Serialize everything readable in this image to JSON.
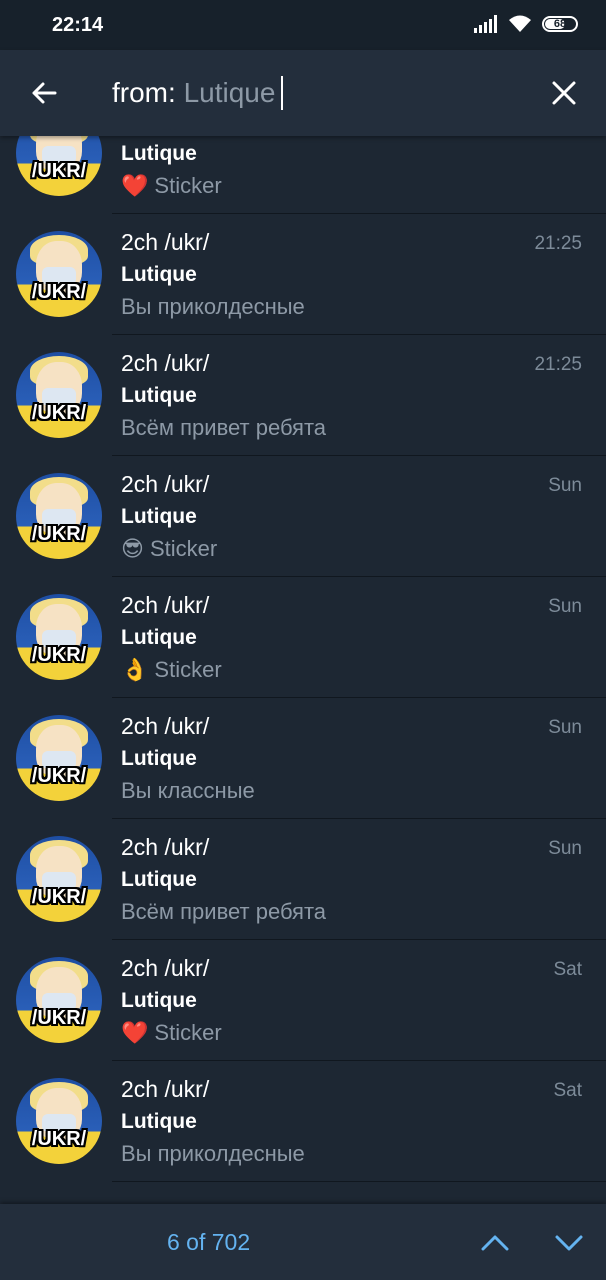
{
  "status_bar": {
    "time": "22:14",
    "battery": "68",
    "battery_level": 0.68
  },
  "search": {
    "prefix": "from: ",
    "query": "Lutique"
  },
  "colors": {
    "accent": "#64b3f0",
    "background": "#1d2733",
    "header": "#232e3c",
    "muted_text": "#8d99a6"
  },
  "results": [
    {
      "title": "",
      "time": "",
      "sender": "Lutique",
      "emoji": "❤️",
      "text": "Sticker"
    },
    {
      "title": "2ch /ukr/",
      "time": "21:25",
      "sender": "Lutique",
      "emoji": "",
      "text": "Вы приколдесные"
    },
    {
      "title": "2ch /ukr/",
      "time": "21:25",
      "sender": "Lutique",
      "emoji": "",
      "text": "Всём привет ребята"
    },
    {
      "title": "2ch /ukr/",
      "time": "Sun",
      "sender": "Lutique",
      "emoji": "😎",
      "text": "Sticker"
    },
    {
      "title": "2ch /ukr/",
      "time": "Sun",
      "sender": "Lutique",
      "emoji": "👌",
      "text": "Sticker"
    },
    {
      "title": "2ch /ukr/",
      "time": "Sun",
      "sender": "Lutique",
      "emoji": "",
      "text": "Вы классные"
    },
    {
      "title": "2ch /ukr/",
      "time": "Sun",
      "sender": "Lutique",
      "emoji": "",
      "text": "Всём привет ребята"
    },
    {
      "title": "2ch /ukr/",
      "time": "Sat",
      "sender": "Lutique",
      "emoji": "❤️",
      "text": "Sticker"
    },
    {
      "title": "2ch /ukr/",
      "time": "Sat",
      "sender": "Lutique",
      "emoji": "",
      "text": "Вы приколдесные"
    }
  ],
  "avatar_label": "/UKR/",
  "bottom_bar": {
    "counter": "6 of 702"
  }
}
